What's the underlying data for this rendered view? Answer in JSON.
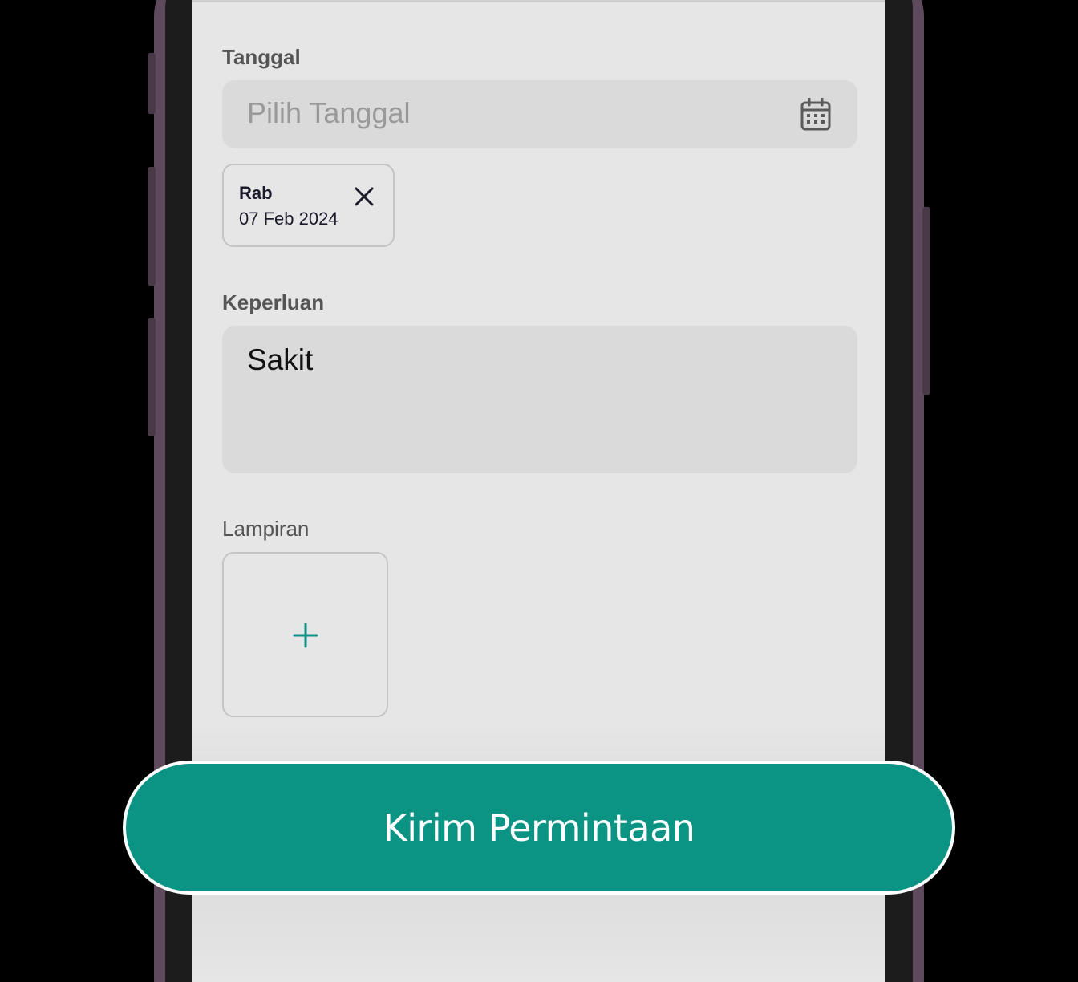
{
  "form": {
    "date_label": "Tanggal",
    "date_placeholder": "Pilih Tanggal",
    "selected_dates": [
      {
        "day": "Rab",
        "date": "07 Feb 2024"
      }
    ],
    "reason_label": "Keperluan",
    "reason_value": "Sakit",
    "attachment_label": "Lampiran"
  },
  "actions": {
    "submit_label": "Kirim Permintaan"
  },
  "icons": {
    "date_input": "calendar-icon",
    "chip_remove": "close-icon",
    "attachment_add": "plus-icon"
  },
  "colors": {
    "accent": "#0b9384",
    "screen_bg": "#e6e6e6",
    "input_bg": "#dadada"
  }
}
